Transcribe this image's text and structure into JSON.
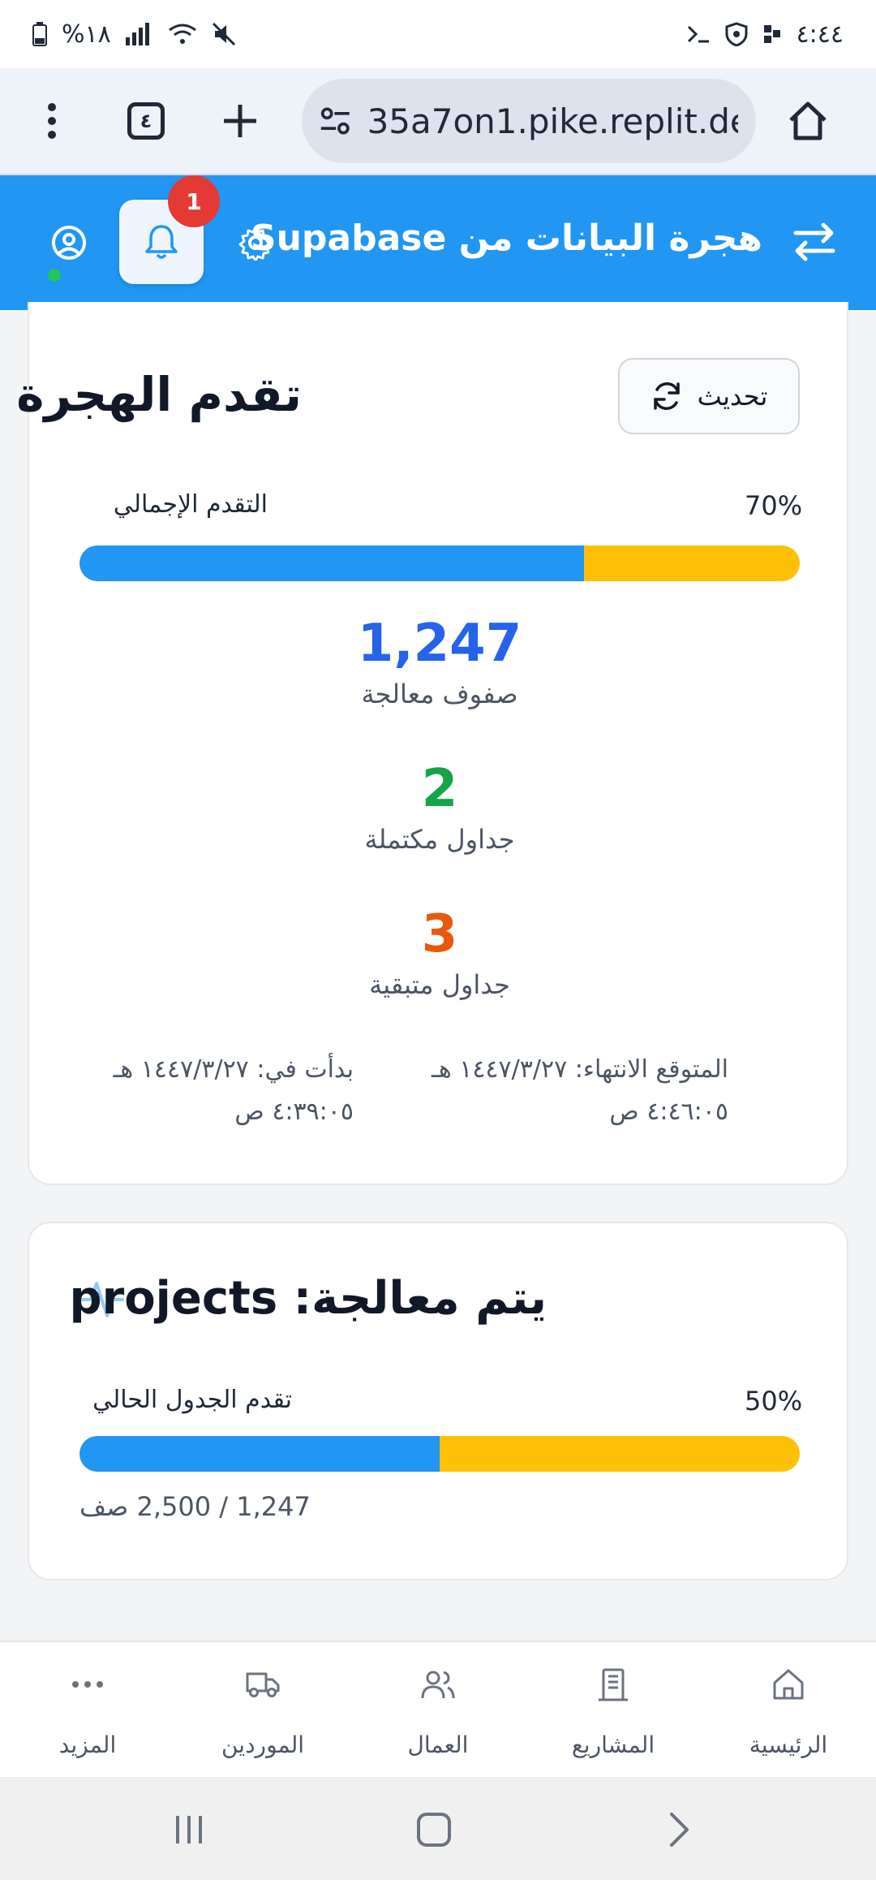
{
  "status_bar": {
    "time": "٤:٤٤",
    "battery": "%١٨"
  },
  "browser": {
    "tab_count": "٤",
    "url": "35a7on1.pike.replit.dev"
  },
  "header": {
    "title": "هجرة البيانات من Supabase",
    "notification_count": "1"
  },
  "progress_card": {
    "title": "تقدم الهجرة",
    "refresh_label": "تحديث",
    "overall_label": "التقدم الإجمالي",
    "overall_percent_text": "70%",
    "overall_fraction": 0.7,
    "stats": [
      {
        "value": "1,247",
        "label": "صفوف معالجة",
        "color": "#2563eb"
      },
      {
        "value": "2",
        "label": "جداول مكتملة",
        "color": "#16a34a"
      },
      {
        "value": "3",
        "label": "جداول متبقية",
        "color": "#ea580c"
      }
    ],
    "started_line1": "بدأت في: ١٤٤٧/٣/٢٧ هـ",
    "started_line2": "٤:٣٩:٠٥ ص",
    "expected_line1": "المتوقع الانتهاء: ١٤٤٧/٣/٢٧ هـ",
    "expected_line2": "٤:٤٦:٠٥ ص"
  },
  "table_card": {
    "title": "يتم معالجة: projects",
    "current_label": "تقدم الجدول الحالي",
    "current_percent_text": "50%",
    "current_fraction": 0.5,
    "rows_text": "1,247 / 2,500 صف"
  },
  "bottom_nav": {
    "items": [
      {
        "label": "الرئيسية",
        "icon": "home-icon"
      },
      {
        "label": "المشاريع",
        "icon": "building-icon"
      },
      {
        "label": "العمال",
        "icon": "users-icon"
      },
      {
        "label": "الموردين",
        "icon": "truck-icon"
      },
      {
        "label": "المزيد",
        "icon": "more-icon"
      }
    ]
  },
  "colors": {
    "primary": "#2196f3",
    "track": "#ffc107",
    "badge": "#e53935"
  }
}
